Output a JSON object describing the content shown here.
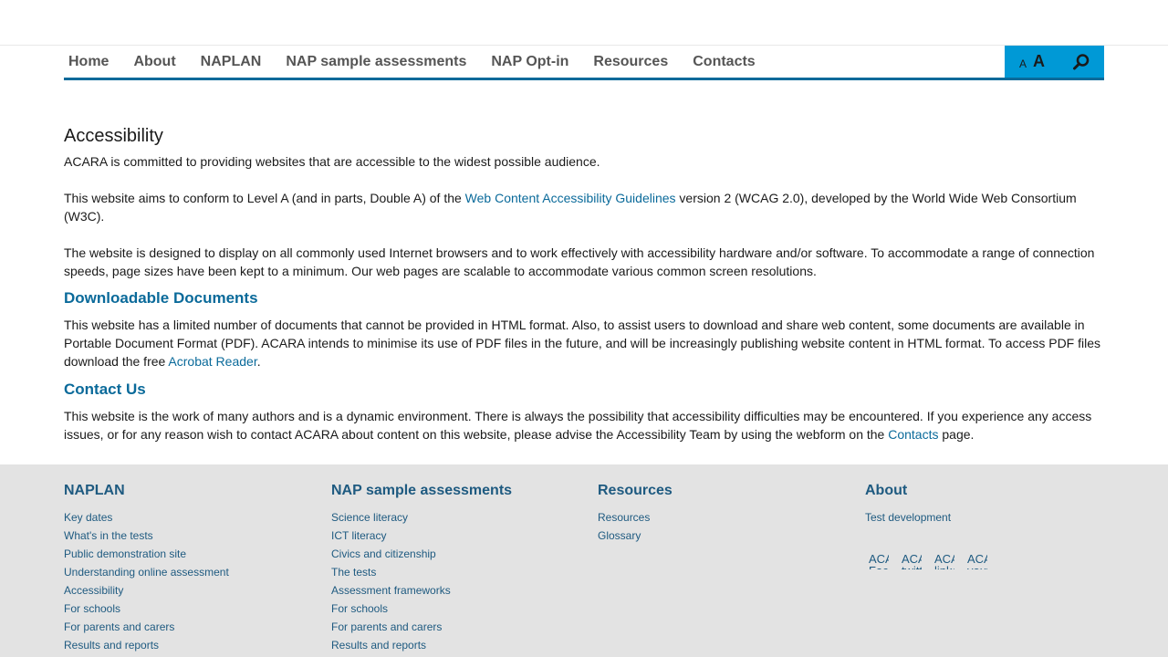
{
  "nav": {
    "items": [
      "Home",
      "About",
      "NAPLAN",
      "NAP sample assessments",
      "NAP Opt-in",
      "Resources",
      "Contacts"
    ],
    "font_small": "A",
    "font_large": "A"
  },
  "main": {
    "title": "Accessibility",
    "p1": "ACARA is committed to providing websites that are accessible to the widest possible audience.",
    "p2_a": "This website aims to conform to Level A (and in parts, Double A) of the ",
    "p2_link": "Web Content Accessibility Guidelines",
    "p2_b": " version 2 (WCAG 2.0), developed by the World Wide Web Consortium (W3C).",
    "p3": "The website is designed to display on all commonly used Internet browsers and to work effectively with accessibility hardware and/or software. To accommodate a range of connection speeds, page sizes have been kept to a minimum. Our web pages are scalable to accommodate various common screen resolutions.",
    "h_downloadable": "Downloadable Documents",
    "p4_a": "This website has a limited number of documents that cannot be provided in HTML format. Also, to assist users to download and share web content, some documents are available in Portable Document Format (PDF). ACARA intends to minimise its use of PDF files in the future, and will be increasingly publishing website content in HTML format. To access PDF files download the free ",
    "p4_link": "Acrobat Reader",
    "p4_b": ".",
    "h_contact": "Contact Us",
    "p5_a": "This website is the work of many authors and is a dynamic environment. There is always the possibility that accessibility difficulties may be encountered. If you experience any access issues, or for any reason wish to contact ACARA about content on this website, please advise the Accessibility Team by using the webform on the ",
    "p5_link": "Contacts",
    "p5_b": " page."
  },
  "footer": {
    "col1": {
      "heading": "NAPLAN",
      "links": [
        "Key dates",
        "What's in the tests",
        "Public demonstration site",
        "Understanding online assessment",
        "Accessibility",
        "For schools",
        "For parents and carers",
        "Results and reports"
      ]
    },
    "col2": {
      "heading": "NAP sample assessments",
      "links": [
        "Science literacy",
        "ICT literacy",
        "Civics and citizenship",
        "The tests",
        "Assessment frameworks",
        "For schools",
        "For parents and carers",
        "Results and reports"
      ]
    },
    "col3": {
      "heading": "Resources",
      "links": [
        "Resources",
        "Glossary"
      ]
    },
    "col4": {
      "heading": "About",
      "links": [
        "Test development"
      ],
      "socials": [
        "ACARA Facebook",
        "ACARA twitter",
        "ACARA linkedin",
        "ACARA youtube"
      ]
    }
  },
  "colors": {
    "accent": "#0a6a9a",
    "tools_bg": "#0099d6",
    "footer_bg": "#e3e3e3",
    "footer_link": "#1e5a80"
  }
}
